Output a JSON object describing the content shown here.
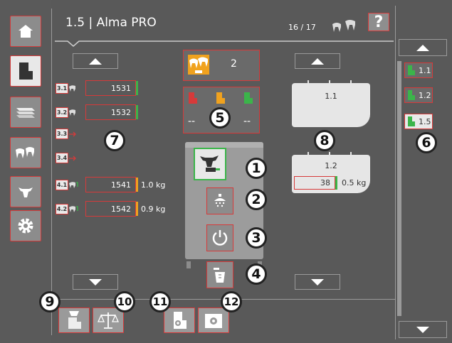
{
  "header": {
    "title": "1.5 | Alma PRO",
    "count": "16 / 17",
    "help_label": "?"
  },
  "sidebar": {
    "items": [
      {
        "icon": "home-icon"
      },
      {
        "icon": "feeder-icon"
      },
      {
        "icon": "stack-icon"
      },
      {
        "icon": "herd-icon"
      },
      {
        "icon": "cow-icon"
      },
      {
        "icon": "gear-icon"
      }
    ]
  },
  "stalls": [
    {
      "tag": "3.1",
      "value": "1531",
      "bar": "#3bb54a",
      "kg": ""
    },
    {
      "tag": "3.2",
      "value": "1532",
      "bar": "#3bb54a",
      "kg": ""
    },
    {
      "tag": "3.3",
      "value": "",
      "bar": "",
      "kg": ""
    },
    {
      "tag": "3.4",
      "value": "",
      "bar": "",
      "kg": ""
    },
    {
      "tag": "4.1",
      "value": "1541",
      "bar": "#f0a21e",
      "kg": "1.0 kg"
    },
    {
      "tag": "4.2",
      "value": "1542",
      "bar": "#f0a21e",
      "kg": "0.9 kg"
    }
  ],
  "center": {
    "top_count": "2",
    "dash_left": "--",
    "dash_right": "--"
  },
  "stations": [
    {
      "label": "1.1",
      "value": "",
      "kg": ""
    },
    {
      "label": "1.2",
      "value": "38",
      "kg": "0.5 kg"
    }
  ],
  "right_list": [
    {
      "label": "1.1"
    },
    {
      "label": "1.2"
    },
    {
      "label": "1.5"
    }
  ],
  "callouts": [
    "1",
    "2",
    "3",
    "4",
    "5",
    "6",
    "7",
    "8",
    "9",
    "10",
    "11",
    "12"
  ],
  "colors": {
    "accent_red": "#d63a3a",
    "green": "#3bb54a",
    "orange": "#f0a21e",
    "bg": "#595959"
  }
}
